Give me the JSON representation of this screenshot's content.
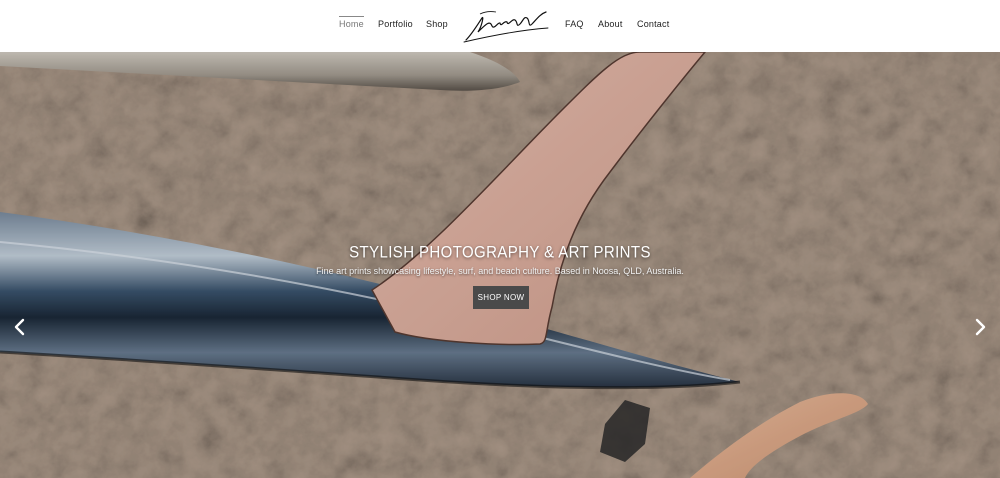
{
  "nav": {
    "left": [
      "Home",
      "Portfolio",
      "Shop"
    ],
    "right": [
      "FAQ",
      "About",
      "Contact"
    ],
    "active": "Home",
    "logo_icon": "signature-logo"
  },
  "hero": {
    "title": "STYLISH PHOTOGRAPHY & ART PRINTS",
    "subtitle": "Fine art prints showcasing lifestyle, surf, and beach culture. Based in Noosa, QLD, Australia.",
    "button_label": "SHOP NOW",
    "prev_icon": "chevron-left-icon",
    "next_icon": "chevron-right-icon"
  },
  "colors": {
    "header_bg": "#ffffff",
    "nav_text": "#222222",
    "button_bg": "#4a4a4a",
    "sand": "#b8a392",
    "fin": "#e8b6a6"
  }
}
